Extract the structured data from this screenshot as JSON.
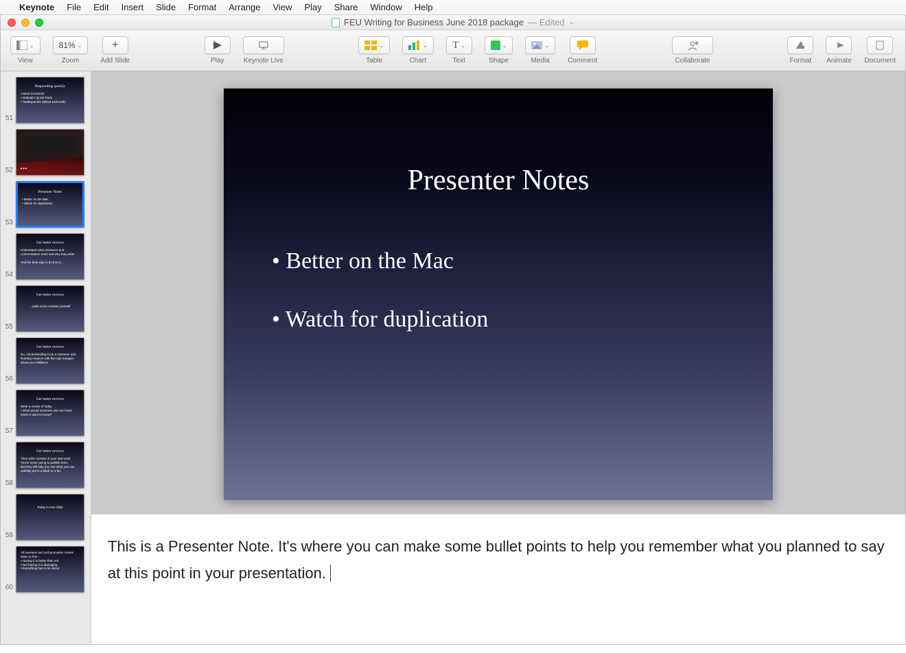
{
  "menubar": {
    "apple": "",
    "appname": "Keynote",
    "items": [
      "File",
      "Edit",
      "Insert",
      "Slide",
      "Format",
      "Arrange",
      "View",
      "Play",
      "Share",
      "Window",
      "Help"
    ]
  },
  "window": {
    "title": "FEU Writing for Business June 2018 package",
    "edited": "— Edited"
  },
  "toolbar": {
    "view": "View",
    "zoom_value": "81%",
    "zoom": "Zoom",
    "add_slide": "Add Slide",
    "play": "Play",
    "keynote_live": "Keynote Live",
    "table": "Table",
    "chart": "Chart",
    "text": "Text",
    "shape": "Shape",
    "media": "Media",
    "comment": "Comment",
    "collaborate": "Collaborate",
    "format": "Format",
    "animate": "Animate",
    "document": "Document"
  },
  "thumbnails": {
    "start_number": 51,
    "selected_index": 2,
    "items": [
      {
        "title": "Responding quickly",
        "body": "• Word document\n• Outlook's Quick Parts\n• TextExpander (about £4/month)"
      },
      {
        "photo": true
      },
      {
        "title": "Presenter Notes",
        "body": "• Better on the Mac\n• Watch for duplication"
      },
      {
        "title": "Get better reviews",
        "body": "Understand what reviewers and commentators need and why they write\n\nAnd the best way to do this is..."
      },
      {
        "title": "Get better reviews",
        "center": "...write some reviews yourself"
      },
      {
        "title": "Get better reviews",
        "body": "No, not pretending to be a customer and flooding Amazon with five-star eulogies about your brilliance"
      },
      {
        "title": "Get better reviews",
        "body": "Write a review of today\n• What would someone who isn't here need or want to know?"
      },
      {
        "title": "Get better reviews",
        "body": "Then write reviews of your own work\nYou're never going to publish them\nBut they will help you see what you can usefully put in a blurb or a bio"
      },
      {
        "title": "",
        "center": "Today in One Slide"
      },
      {
        "title": "",
        "body": "All business and self-promotion comes down to this –\n• Having it is better than not\n• Not having it is damaging\n• Everything has to be about"
      }
    ]
  },
  "slide": {
    "title": "Presenter Notes",
    "bullet1": "Better on the Mac",
    "bullet2": "Watch for duplication"
  },
  "notes_text": "This is a Presenter Note. It's where you can make some bullet points to help you remember what you planned to say at this point in your presentation."
}
